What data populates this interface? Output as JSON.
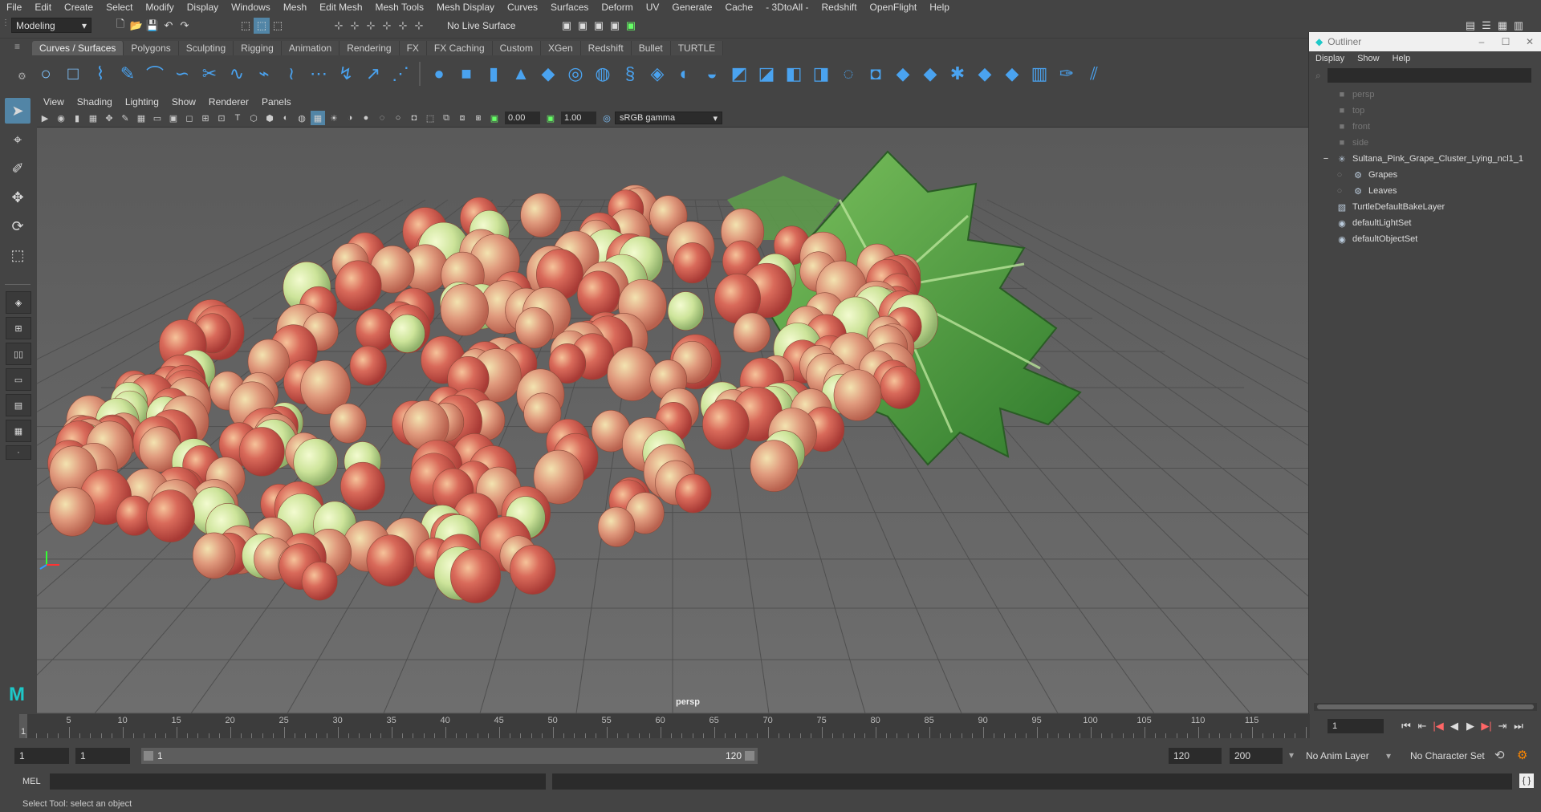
{
  "menubar": {
    "items": [
      "File",
      "Edit",
      "Create",
      "Select",
      "Modify",
      "Display",
      "Windows",
      "Mesh",
      "Edit Mesh",
      "Mesh Tools",
      "Mesh Display",
      "Curves",
      "Surfaces",
      "Deform",
      "UV",
      "Generate",
      "Cache",
      "- 3DtoAll -",
      "Redshift",
      "OpenFlight",
      "Help"
    ]
  },
  "statusline": {
    "mode": "Modeling",
    "live_surface": "No Live Surface"
  },
  "shelf": {
    "tabs": [
      "Curves / Surfaces",
      "Polygons",
      "Sculpting",
      "Rigging",
      "Animation",
      "Rendering",
      "FX",
      "FX Caching",
      "Custom",
      "XGen",
      "Redshift",
      "Bullet",
      "TURTLE"
    ],
    "active_tab": "Curves / Surfaces"
  },
  "viewport": {
    "menu": [
      "View",
      "Shading",
      "Lighting",
      "Show",
      "Renderer",
      "Panels"
    ],
    "exposure": "0.00",
    "gamma": "1.00",
    "color_space": "sRGB gamma",
    "camera_label": "persp"
  },
  "outliner": {
    "title": "Outliner",
    "menu": [
      "Display",
      "Show",
      "Help"
    ],
    "rows": [
      {
        "label": "persp",
        "icon": "camera-icon",
        "indent": 0,
        "dim": true
      },
      {
        "label": "top",
        "icon": "camera-icon",
        "indent": 0,
        "dim": true
      },
      {
        "label": "front",
        "icon": "camera-icon",
        "indent": 0,
        "dim": true
      },
      {
        "label": "side",
        "icon": "camera-icon",
        "indent": 0,
        "dim": true
      },
      {
        "label": "Sultana_Pink_Grape_Cluster_Lying_ncl1_1",
        "icon": "transform-icon",
        "indent": 0,
        "dim": false,
        "expander": "−"
      },
      {
        "label": "Grapes",
        "icon": "mesh-icon",
        "indent": 1,
        "dim": false
      },
      {
        "label": "Leaves",
        "icon": "mesh-icon",
        "indent": 1,
        "dim": false
      },
      {
        "label": "TurtleDefaultBakeLayer",
        "icon": "layer-icon",
        "indent": 0,
        "dim": false
      },
      {
        "label": "defaultLightSet",
        "icon": "set-icon",
        "indent": 0,
        "dim": false
      },
      {
        "label": "defaultObjectSet",
        "icon": "set-icon",
        "indent": 0,
        "dim": false
      }
    ]
  },
  "timeline": {
    "ticks": [
      "5",
      "10",
      "15",
      "20",
      "25",
      "30",
      "35",
      "40",
      "45",
      "50",
      "55",
      "60",
      "65",
      "70",
      "75",
      "80",
      "85",
      "90",
      "95",
      "100",
      "105",
      "110",
      "115"
    ],
    "start_label": "1",
    "current_frame": "1"
  },
  "range": {
    "start_frame": "1",
    "playback_start": "1",
    "slider_start": "1",
    "slider_end": "120",
    "playback_end": "120",
    "end_frame": "200",
    "anim_layer": "No Anim Layer",
    "character_set": "No Character Set"
  },
  "cmdline": {
    "label": "MEL"
  },
  "helpline": {
    "text": "Select Tool: select an object"
  },
  "colors": {
    "accent": "#5285a6",
    "shelf_icon": "#4aa3f0",
    "panel": "#444444"
  }
}
